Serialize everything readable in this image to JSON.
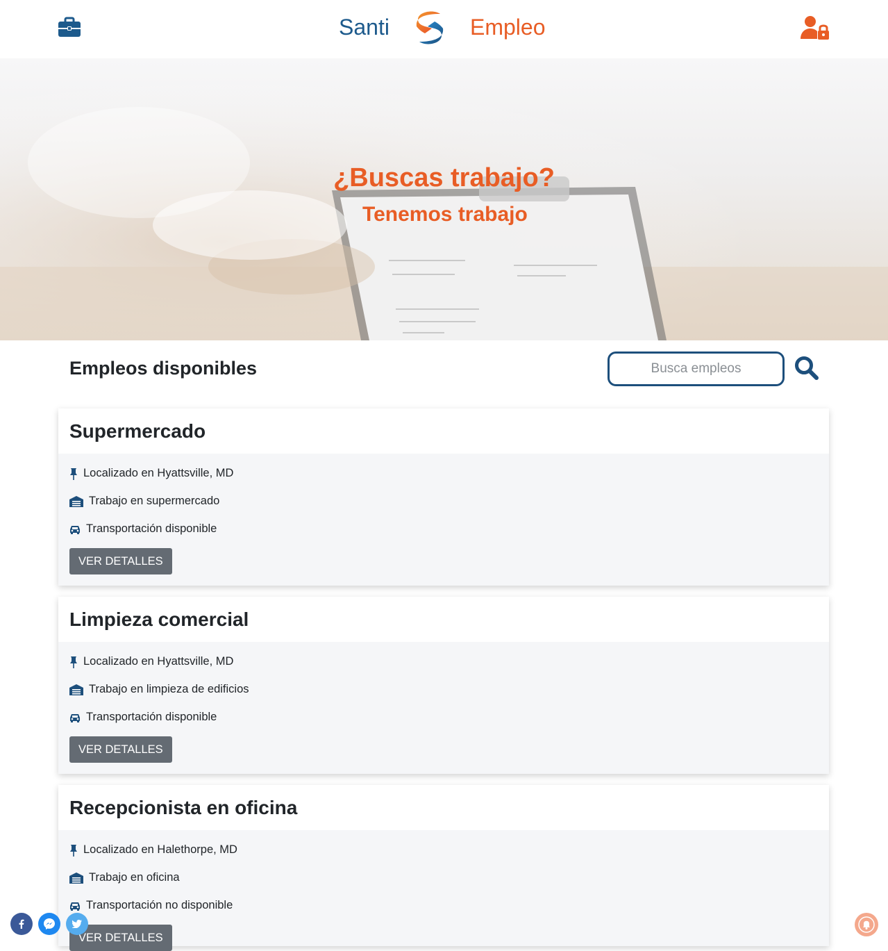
{
  "header": {
    "brand_left": "Santi",
    "brand_right": "Empleo",
    "brief_icon": "briefcase-icon",
    "login_icon": "user-lock-icon"
  },
  "hero": {
    "title": "¿Buscas trabajo?",
    "subtitle": "Tenemos trabajo"
  },
  "jobs_section": {
    "title": "Empleos disponibles",
    "search_placeholder": "Busca empleos",
    "search_icon": "search-icon"
  },
  "jobs": [
    {
      "title": "Supermercado",
      "location": "Localizado en Hyattsville, MD",
      "type": "Trabajo en supermercado",
      "transport": "Transportación disponible",
      "button": "VER DETALLES"
    },
    {
      "title": "Limpieza comercial",
      "location": "Localizado en Hyattsville, MD",
      "type": "Trabajo en limpieza de edificios",
      "transport": "Transportación disponible",
      "button": "VER DETALLES"
    },
    {
      "title": "Recepcionista en oficina",
      "location": "Localizado en Halethorpe, MD",
      "type": "Trabajo en oficina",
      "transport": "Transportación no disponible",
      "button": "VER DETALLES"
    }
  ],
  "social": [
    "facebook-icon",
    "messenger-icon",
    "twitter-icon"
  ],
  "colors": {
    "brand_blue": "#1d5a8c",
    "brand_orange": "#e85d25",
    "button_gray": "#646b73",
    "card_bg": "#f5f6f8"
  }
}
